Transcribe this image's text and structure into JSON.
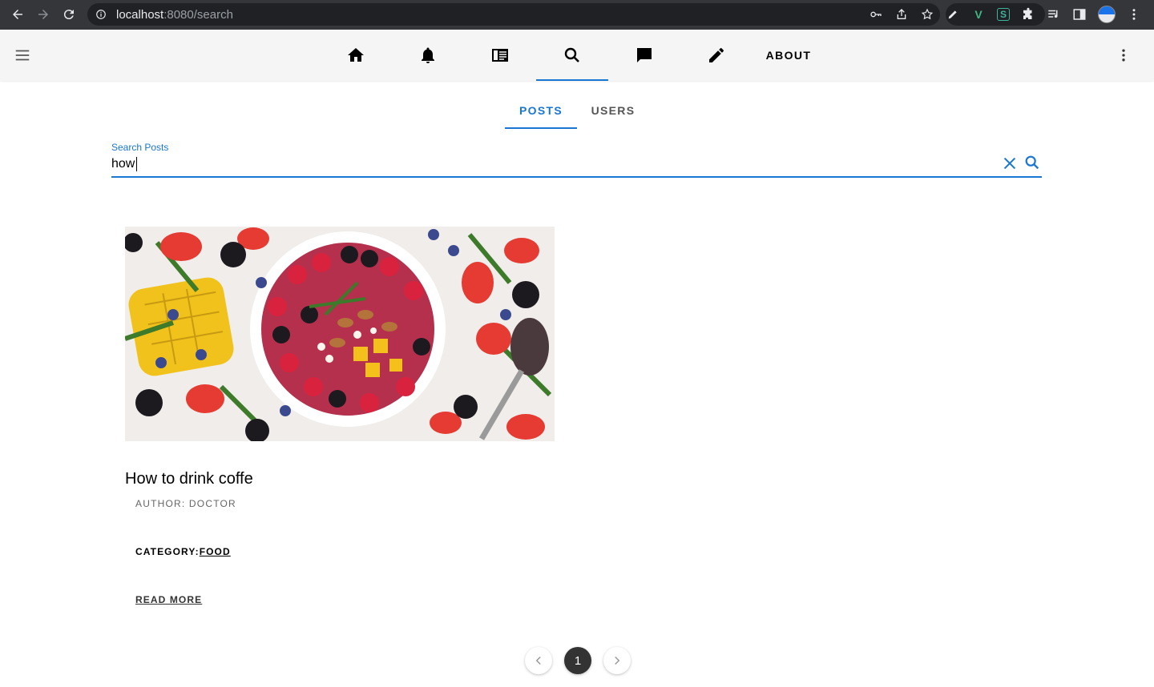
{
  "browser": {
    "url_host": "localhost",
    "url_path": ":8080/search"
  },
  "appbar": {
    "tabs": [
      {
        "name": "home",
        "icon": "home-icon"
      },
      {
        "name": "notifications",
        "icon": "bell-icon"
      },
      {
        "name": "feed",
        "icon": "newspaper-icon"
      },
      {
        "name": "search",
        "icon": "search-icon",
        "active": true
      },
      {
        "name": "messages",
        "icon": "chat-icon"
      },
      {
        "name": "write",
        "icon": "pencil-icon"
      }
    ],
    "about_label": "ABOUT"
  },
  "subtabs": {
    "posts_label": "POSTS",
    "users_label": "USERS",
    "active": "POSTS"
  },
  "search": {
    "label": "Search Posts",
    "value": "how"
  },
  "results": [
    {
      "title": "How to drink coffe",
      "author": "AUTHOR: DOCTOR",
      "category_prefix": "CATEGORY:",
      "category": "FOOD",
      "read_more": "READ MORE",
      "image": "fruit-bowl-photo"
    }
  ],
  "pagination": {
    "current_page": "1"
  },
  "colors": {
    "accent": "#1976d2",
    "appbar_bg": "#f5f5f5",
    "chrome_bg": "#35363a"
  }
}
